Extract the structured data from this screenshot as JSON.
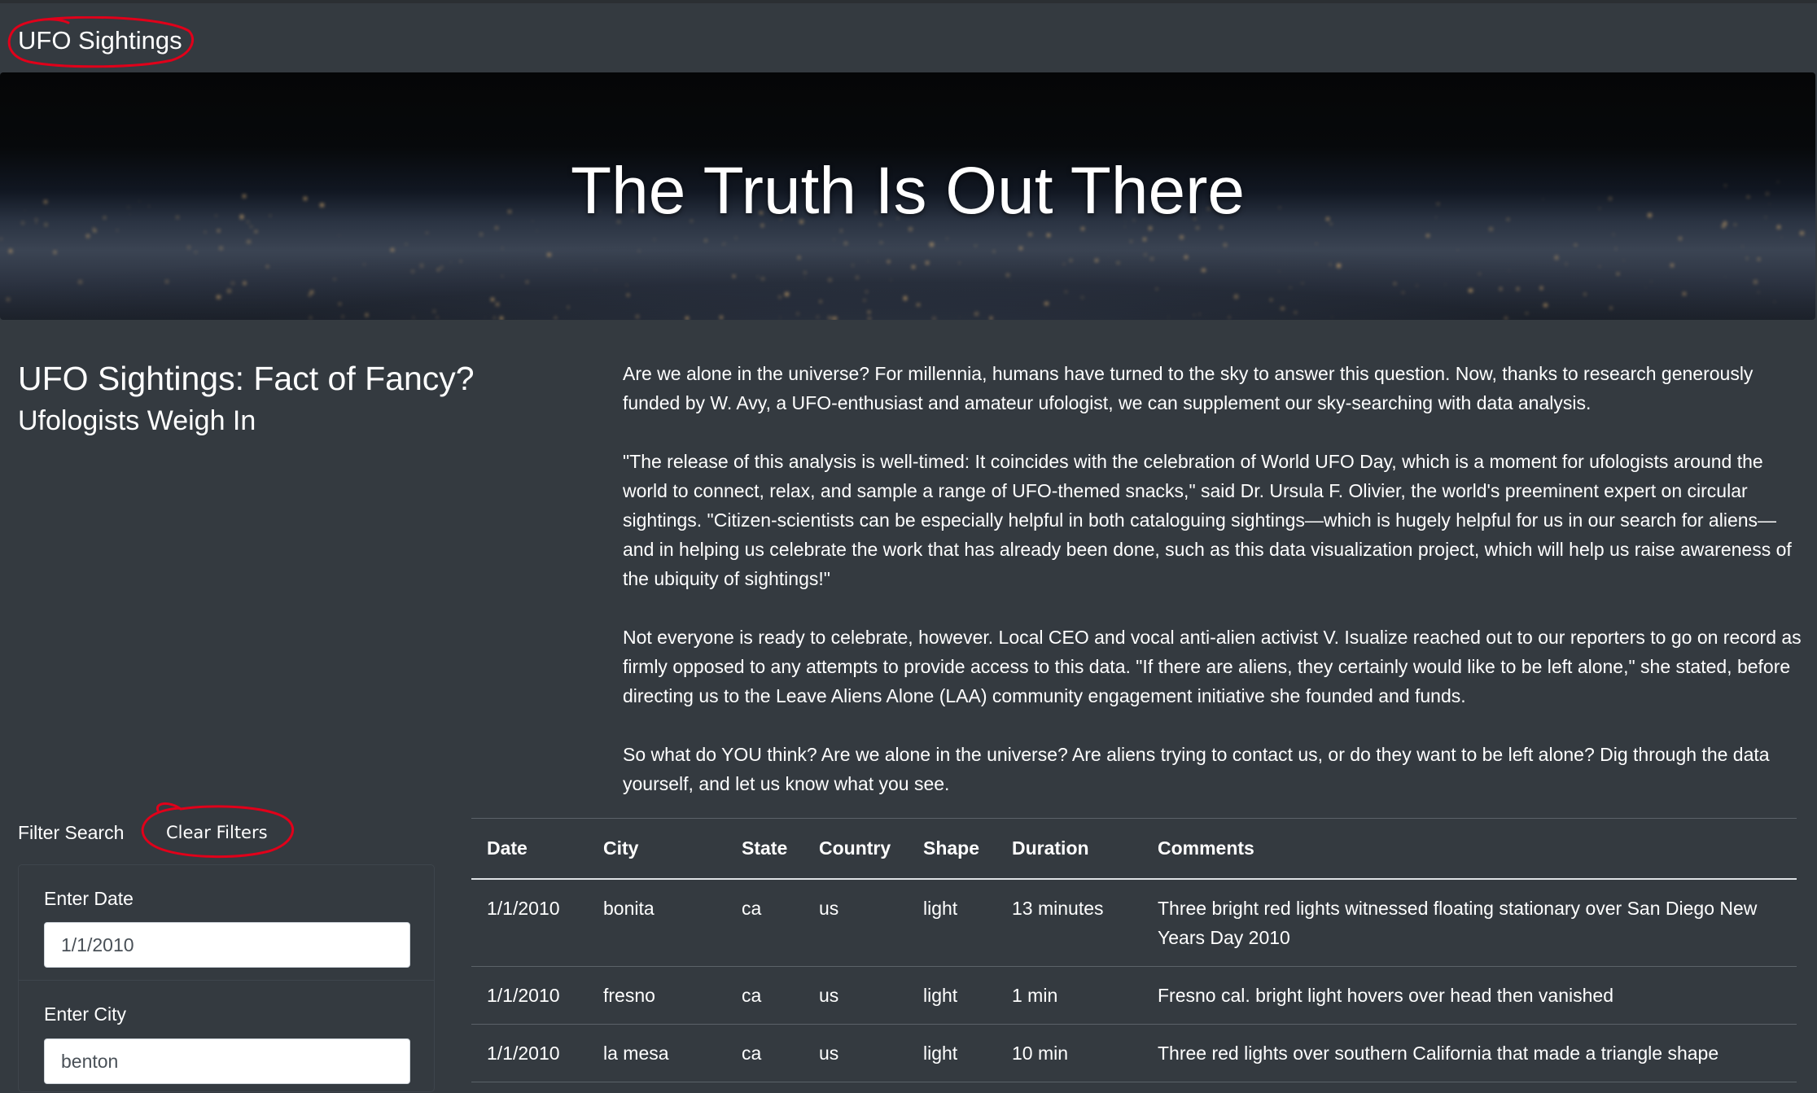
{
  "navbar": {
    "brand": "UFO Sightings"
  },
  "hero": {
    "title": "The Truth Is Out There"
  },
  "intro": {
    "heading": "UFO Sightings: Fact of Fancy?",
    "subheading": "Ufologists Weigh In"
  },
  "article": {
    "paragraphs": [
      "Are we alone in the universe? For millennia, humans have turned to the sky to answer this question. Now, thanks to research generously funded by W. Avy, a UFO-enthusiast and amateur ufologist, we can supplement our sky-searching with data analysis.",
      "\"The release of this analysis is well-timed: It coincides with the celebration of World UFO Day, which is a moment for ufologists around the world to connect, relax, and sample a range of UFO-themed snacks,\" said Dr. Ursula F. Olivier, the world's preeminent expert on circular sightings. \"Citizen-scientists can be especially helpful in both cataloguing sightings—which is hugely helpful for us in our search for aliens—and in helping us celebrate the work that has already been done, such as this data visualization project, which will help us raise awareness of the ubiquity of sightings!\"",
      "Not everyone is ready to celebrate, however. Local CEO and vocal anti-alien activist V. Isualize reached out to our reporters to go on record as firmly opposed to any attempts to provide access to this data. \"If there are aliens, they certainly would like to be left alone,\" she stated, before directing us to the Leave Aliens Alone (LAA) community engagement initiative she founded and funds.",
      "So what do YOU think? Are we alone in the universe? Are aliens trying to contact us, or do they want to be left alone? Dig through the data yourself, and let us know what you see."
    ]
  },
  "filters": {
    "title": "Filter Search",
    "clear_label": "Clear Filters",
    "date": {
      "label": "Enter Date",
      "value": "1/1/2010"
    },
    "city": {
      "label": "Enter City",
      "value": "benton"
    }
  },
  "table": {
    "headers": [
      "Date",
      "City",
      "State",
      "Country",
      "Shape",
      "Duration",
      "Comments"
    ],
    "rows": [
      [
        "1/1/2010",
        "bonita",
        "ca",
        "us",
        "light",
        "13 minutes",
        "Three bright red lights witnessed floating stationary over San Diego New Years Day 2010"
      ],
      [
        "1/1/2010",
        "fresno",
        "ca",
        "us",
        "light",
        "1 min",
        "Fresno cal. bright light hovers over head then vanished"
      ],
      [
        "1/1/2010",
        "la mesa",
        "ca",
        "us",
        "light",
        "10 min",
        "Three red lights over southern California that made a triangle shape"
      ]
    ]
  },
  "colors": {
    "background": "#343a40",
    "text": "#ffffff",
    "annotation": "#e0001a"
  }
}
